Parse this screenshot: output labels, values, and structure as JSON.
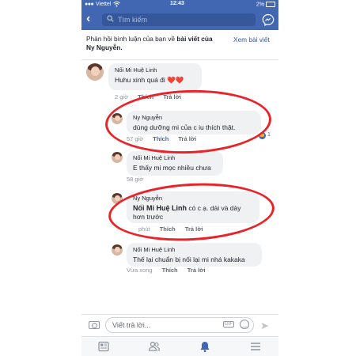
{
  "status_bar": {
    "carrier": "Viettel",
    "time": "12:43",
    "battery": "2%"
  },
  "nav": {
    "back_icon": "chevron-left-icon",
    "search_placeholder": "Tìm kiếm",
    "messenger_icon": "messenger-icon",
    "bar_color": "#4267b2"
  },
  "notice": {
    "prefix": "Phản hồi bình luận của bạn về ",
    "post_link": "bài viết của",
    "author": "Ny Nguyễn.",
    "view_post": "Xem bài viết"
  },
  "comments": [
    {
      "name": "Nối Mi Huệ Linh",
      "text": "Huhu xinh quá đi",
      "reaction_emoji": "❤️❤️",
      "time": "2 giờ",
      "like_label": "Thích",
      "reply_label": "Trả lời"
    },
    {
      "name": "Ny Nguyễn",
      "text": "dùng dưỡng mi của c iu thích thật.",
      "time": "57 giờ",
      "like_label": "Thích",
      "reply_label": "Trả lời",
      "like_count": "1"
    },
    {
      "name": "Nối Mi Huệ Linh",
      "text": "E thấy mi mọc nhiều chưa",
      "time": "58 giờ"
    },
    {
      "name": "Ny Nguyễn",
      "tag": "Nối Mi Huệ Linh",
      "text": " có c ạ. dài và dày hơn trước",
      "time": "phút",
      "like_label": "Thích",
      "reply_label": "Trả lời"
    },
    {
      "name": "Nối Mi Huệ Linh",
      "text": "Thế lại chuẩn bị nối lại mi nhá kakaka",
      "time": "Vừa xong",
      "like_label": "Thích",
      "reply_label": "Trả lời"
    }
  ],
  "reply_bar": {
    "camera_icon": "camera-icon",
    "placeholder": "Viết trả lời...",
    "gif_label": "GIF",
    "emoji_icon": "emoji-icon",
    "send_icon": "send-icon"
  },
  "tab_bar": [
    {
      "icon": "news-feed-icon"
    },
    {
      "icon": "friends-icon"
    },
    {
      "icon": "notifications-bell-icon"
    },
    {
      "icon": "menu-icon"
    }
  ],
  "highlight_color": "#e8242a"
}
